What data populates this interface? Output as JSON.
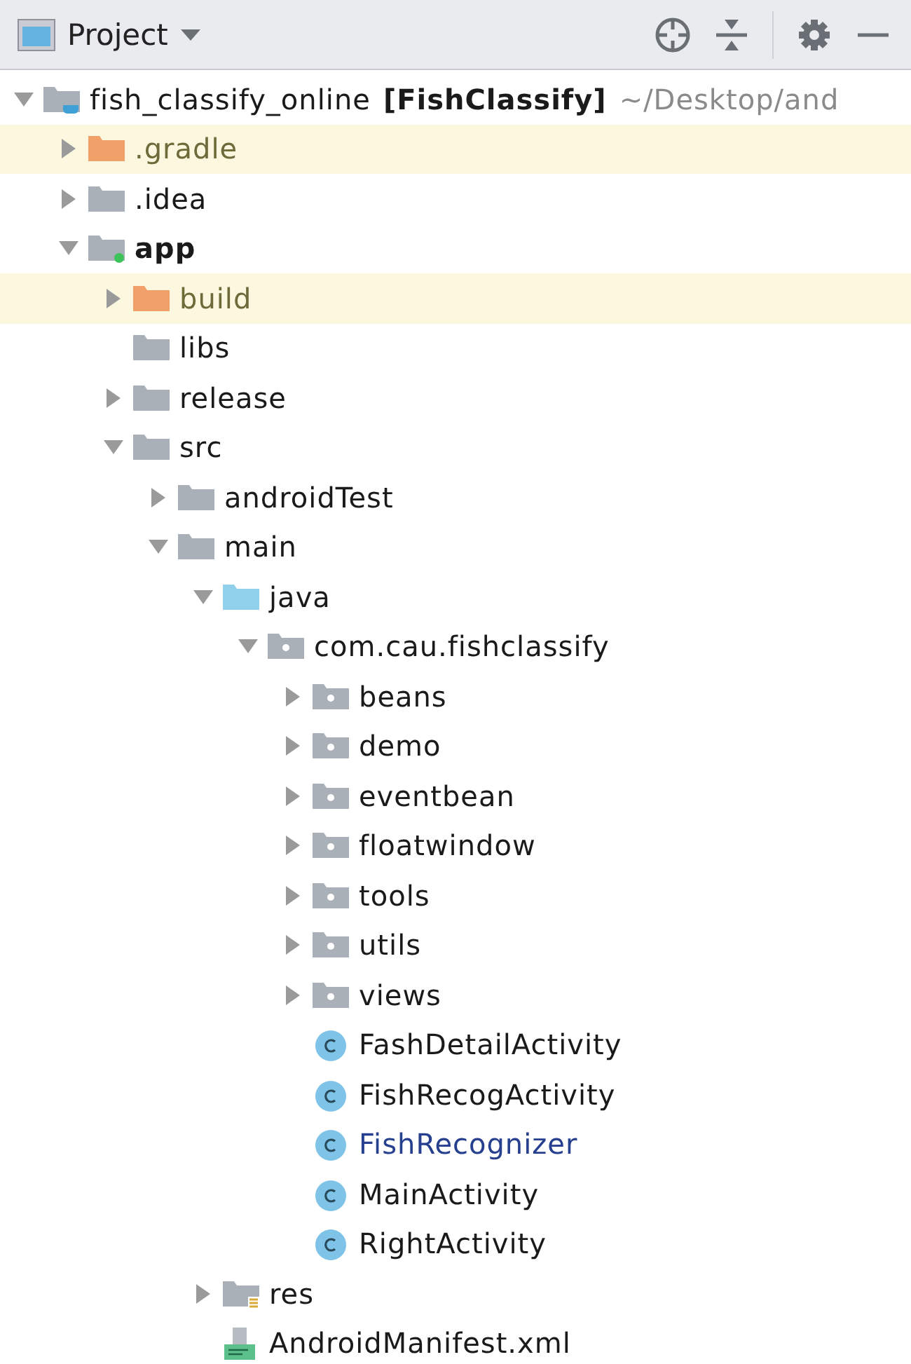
{
  "header": {
    "title": "Project"
  },
  "tree": [
    {
      "kind": "project",
      "label": "fish_classify_online",
      "module": "[FishClassify]",
      "path": "~/Desktop/and",
      "expanded": true,
      "children": [
        {
          "kind": "excluded",
          "label": ".gradle",
          "expanded": false
        },
        {
          "kind": "folder",
          "label": ".idea",
          "expanded": false
        },
        {
          "kind": "module",
          "label": "app",
          "expanded": true,
          "children": [
            {
              "kind": "excluded",
              "label": "build",
              "expanded": false
            },
            {
              "kind": "folder",
              "label": "libs"
            },
            {
              "kind": "folder",
              "label": "release",
              "expanded": false
            },
            {
              "kind": "folder",
              "label": "src",
              "expanded": true,
              "children": [
                {
                  "kind": "folder",
                  "label": "androidTest",
                  "expanded": false
                },
                {
                  "kind": "folder",
                  "label": "main",
                  "expanded": true,
                  "children": [
                    {
                      "kind": "source",
                      "label": "java",
                      "expanded": true,
                      "children": [
                        {
                          "kind": "package",
                          "label": "com.cau.fishclassify",
                          "expanded": true,
                          "children": [
                            {
                              "kind": "package",
                              "label": "beans",
                              "expanded": false
                            },
                            {
                              "kind": "package",
                              "label": "demo",
                              "expanded": false
                            },
                            {
                              "kind": "package",
                              "label": "eventbean",
                              "expanded": false
                            },
                            {
                              "kind": "package",
                              "label": "floatwindow",
                              "expanded": false
                            },
                            {
                              "kind": "package",
                              "label": "tools",
                              "expanded": false
                            },
                            {
                              "kind": "package",
                              "label": "utils",
                              "expanded": false
                            },
                            {
                              "kind": "package",
                              "label": "views",
                              "expanded": false
                            },
                            {
                              "kind": "class",
                              "label": "FashDetailActivity",
                              "modified": false
                            },
                            {
                              "kind": "class",
                              "label": "FishRecogActivity",
                              "modified": false
                            },
                            {
                              "kind": "class",
                              "label": "FishRecognizer",
                              "modified": true
                            },
                            {
                              "kind": "class",
                              "label": "MainActivity",
                              "modified": false
                            },
                            {
                              "kind": "class",
                              "label": "RightActivity",
                              "modified": false
                            }
                          ]
                        }
                      ]
                    },
                    {
                      "kind": "resources",
                      "label": "res",
                      "expanded": false
                    },
                    {
                      "kind": "manifest",
                      "label": "AndroidManifest.xml"
                    }
                  ]
                }
              ]
            }
          ]
        }
      ]
    }
  ]
}
